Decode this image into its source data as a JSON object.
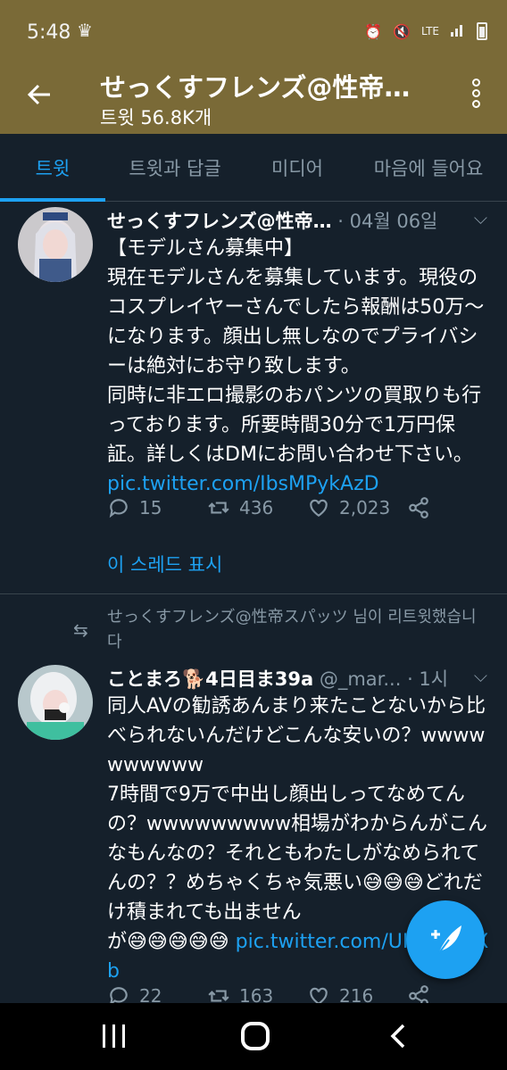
{
  "status": {
    "time": "5:48",
    "icons": [
      "crown-icon",
      "alarm-icon",
      "mute-icon",
      "volte-icon",
      "lte-icon",
      "signal-icon",
      "battery-icon"
    ],
    "lte": "LTE"
  },
  "header": {
    "title": "せっくすフレンズ@性帝…",
    "subtitle": "트윗 56.8K개"
  },
  "tabs": [
    {
      "label": "트윗",
      "active": true
    },
    {
      "label": "트윗과 답글",
      "active": false
    },
    {
      "label": "미디어",
      "active": false
    },
    {
      "label": "마음에 들어요",
      "active": false
    }
  ],
  "tweets": [
    {
      "name": "せっくすフレンズ@性帝…",
      "meta": " · 04월 06일",
      "text": "【モデルさん募集中】\n現在モデルさんを募集しています。現役のコスプレイヤーさんでしたら報酬は50万〜になります。顔出し無しなのでプライバシーは絶対にお守り致します。\n同時に非エロ撮影のおパンツの買取りも行っております。所要時間30分で1万円保証。詳しくはDMにお問い合わせ下さい。",
      "link": "pic.twitter.com/IbsMPykAzD",
      "replies": "15",
      "retweets": "436",
      "likes": "2,023",
      "thread": "이 스레드 표시"
    },
    {
      "retweeted_by": "せっくすフレンズ@性帝スパッツ 님이 리트윗했습니다",
      "name": "ことまろ🐕4日目ま39a",
      "meta": " @_mar... · 1시",
      "text": "同人AVの勧誘あんまり来たことないから比べられないんだけどこんな安いの？wwwwwwwwww\n7時間で9万で中出し顔出しってなめてんの？wwwwwwwww相場がわからんがこんなもんなの？それともわたしがなめられてんの？？めちゃくちゃ気悪い😅😅😅どれだけ積まれても出ません\nが😅😅😅😅😅 ",
      "link": "pic.twitter.com/UIWlBjLuXb",
      "replies": "22",
      "retweets": "163",
      "likes": "216"
    }
  ],
  "colors": {
    "accent": "#1da1f2",
    "background": "#15202b",
    "header": "#7a6a37",
    "muted": "#8899a6"
  }
}
